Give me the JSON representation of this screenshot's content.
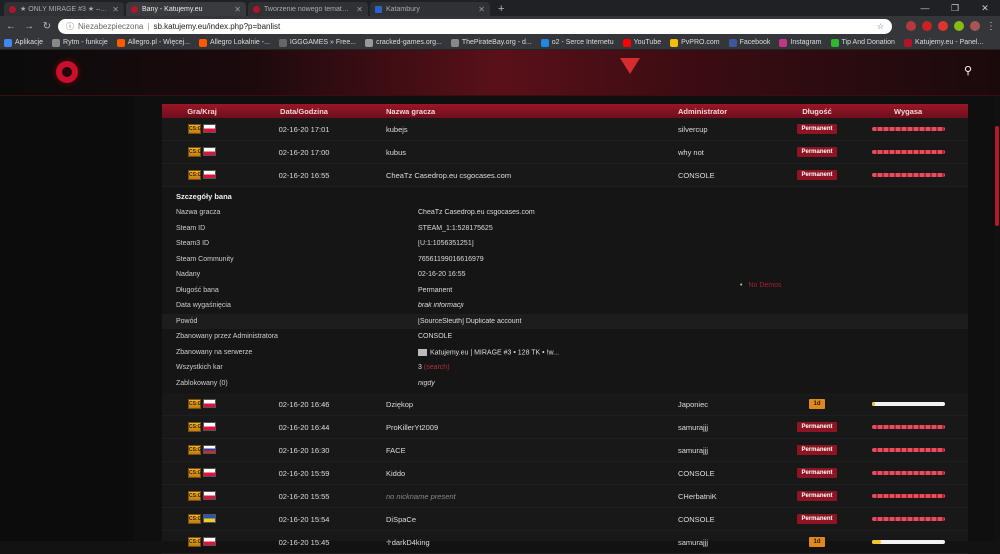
{
  "browser": {
    "tabs": [
      {
        "title": "★ ONLY MIRAGE #3 ★ – Katujem",
        "active": false
      },
      {
        "title": "Bany - Katujemy.eu",
        "active": true
      },
      {
        "title": "Tworzenie nowego tematu - Kat",
        "active": false
      },
      {
        "title": "Katambury",
        "active": false
      }
    ],
    "new_tab": "+",
    "security": "Niezabezpieczona",
    "url": "sb.katujemy.eu/index.php?p=banlist",
    "bookmarks": [
      {
        "label": "Aplikacje",
        "color": "#4285f4"
      },
      {
        "label": "Rytm - funkcje",
        "color": "#888888"
      },
      {
        "label": "Allegro.pl - Więcej...",
        "color": "#ff5a00"
      },
      {
        "label": "Allegro Lokalnie -...",
        "color": "#ff5a00"
      },
      {
        "label": "IGGGAMES » Free...",
        "color": "#666666"
      },
      {
        "label": "cracked-games.org...",
        "color": "#999999"
      },
      {
        "label": "ThePirateBay.org - d...",
        "color": "#888888"
      },
      {
        "label": "o2 - Serce Internetu",
        "color": "#1e88e5"
      },
      {
        "label": "YouTube",
        "color": "#ff0000"
      },
      {
        "label": "PvPRO.com",
        "color": "#f0c000"
      },
      {
        "label": "Facebook",
        "color": "#3b5998"
      },
      {
        "label": "Instagram",
        "color": "#c13584"
      },
      {
        "label": "Tip And Donation",
        "color": "#2eb82e"
      },
      {
        "label": "Katujemy.eu - Panel...",
        "color": "#b01528"
      }
    ]
  },
  "table": {
    "headers": {
      "mod": "Gra/Kraj",
      "date": "Data/Godzina",
      "name": "Nazwa gracza",
      "admin": "Administrator",
      "length": "Długość",
      "expires": "Wygasa"
    },
    "rows_top": [
      {
        "date": "02-16-20 17:01",
        "name": "kubejs",
        "admin": "silvercup",
        "length": "Permanent",
        "flag": "pl"
      },
      {
        "date": "02-16-20 17:00",
        "name": "kubus",
        "admin": "why not",
        "length": "Permanent",
        "flag": "pl"
      },
      {
        "date": "02-16-20 16:55",
        "name": "CheaTz Casedrop.eu csgocases.com",
        "admin": "CONSOLE",
        "length": "Permanent",
        "flag": "pl"
      }
    ],
    "rows_bottom": [
      {
        "date": "02-16-20 16:46",
        "name": "Dziękop",
        "admin": "Japoniec",
        "length": "1d",
        "flag": "pl",
        "progress": 0.04
      },
      {
        "date": "02-16-20 16:44",
        "name": "ProKillerYt2009",
        "admin": "samurajjj",
        "length": "Permanent",
        "flag": "pl"
      },
      {
        "date": "02-16-20 16:30",
        "name": "FACE",
        "admin": "samurajjj",
        "length": "Permanent",
        "flag": "ru"
      },
      {
        "date": "02-16-20 15:59",
        "name": "Kiddo",
        "admin": "CONSOLE",
        "length": "Permanent",
        "flag": "pl"
      },
      {
        "date": "02-16-20 15:55",
        "name": "no nickname present",
        "admin": "CHerbatniK",
        "length": "Permanent",
        "flag": "pl",
        "italic": true
      },
      {
        "date": "02-16-20 15:54",
        "name": "DiSpaCe",
        "admin": "CONSOLE",
        "length": "Permanent",
        "flag": "ua"
      },
      {
        "date": "02-16-20 15:45",
        "name": "♱darkD4king",
        "admin": "samurajjj",
        "length": "1d",
        "flag": "pl",
        "progress": 0.12
      }
    ],
    "game_label": "CS:GO"
  },
  "details": {
    "title": "Szczegóły bana",
    "rows": [
      {
        "k": "Nazwa gracza",
        "v": "CheaTz Casedrop.eu csgocases.com"
      },
      {
        "k": "Steam ID",
        "v": "STEAM_1:1:528175625"
      },
      {
        "k": "Steam3 ID",
        "v": "[U:1:1056351251]",
        "red": true
      },
      {
        "k": "Steam Community",
        "v": "76561199016616979",
        "red": true
      },
      {
        "k": "Nadany",
        "v": "02-16-20 16:55"
      },
      {
        "k": "Długość bana",
        "v": "Permanent"
      },
      {
        "k": "Data wygaśnięcia",
        "v": "brak informacji",
        "italic": true
      },
      {
        "k": "Powód",
        "v": "[SourceSleuth] Duplicate account",
        "hl": true
      },
      {
        "k": "Zbanowany przez Administratora",
        "v": "CONSOLE"
      },
      {
        "k": "Zbanowany na serwerze",
        "v": "Katujemy.eu | MIRAGE #3 • 128 TK • !w...",
        "server": true
      },
      {
        "k": "Wszystkich kar",
        "v": "3",
        "extra": "(search)"
      },
      {
        "k": "Zablokowany (0)",
        "v": "nigdy",
        "italic": true
      }
    ],
    "demos": "No Demos"
  }
}
